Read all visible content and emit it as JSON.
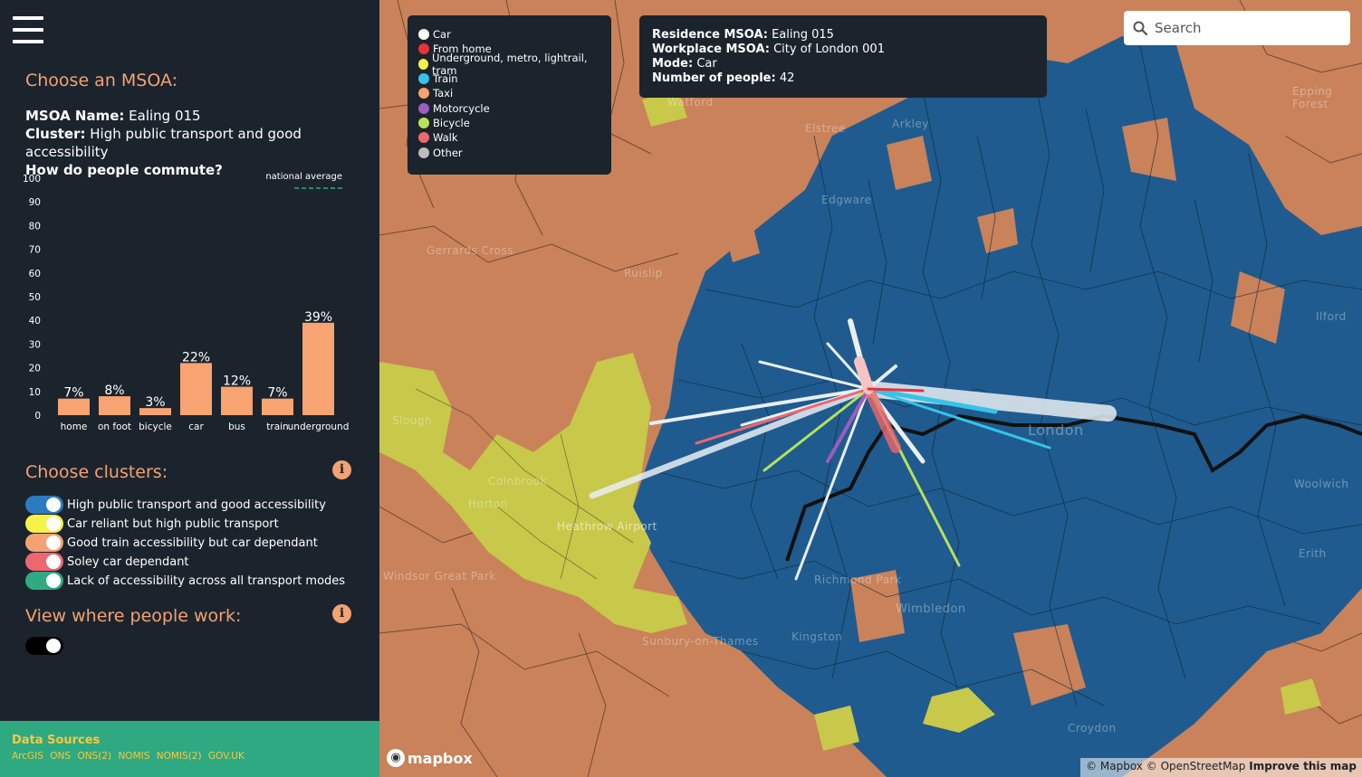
{
  "sidebar": {
    "menu_icon": "hamburger-icon",
    "choose_msoa_title": "Choose an MSOA:",
    "msoa": {
      "name_label": "MSOA Name:",
      "name_value": "Ealing 015",
      "cluster_label": "Cluster:",
      "cluster_value": "High public transport and good accessibility",
      "commute_question": "How do people commute?"
    },
    "choose_clusters_title": "Choose clusters:",
    "clusters": [
      {
        "label": "High public transport and good accessibility",
        "color": "#2b7bc0",
        "on": true
      },
      {
        "label": "Car reliant but high public transport",
        "color": "#f5f24a",
        "on": true
      },
      {
        "label": "Good train accessibility but car dependant",
        "color": "#f4a173",
        "on": true
      },
      {
        "label": "Soley car dependant",
        "color": "#ee6670",
        "on": true
      },
      {
        "label": "Lack of accessibility across all transport modes",
        "color": "#2fa981",
        "on": true
      }
    ],
    "view_work_title": "View where people work:",
    "view_work_toggle": {
      "on": false
    },
    "info_icon": "i",
    "data_sources": {
      "title": "Data Sources",
      "links": [
        "ArcGIS",
        "ONS",
        "ONS(2)",
        "NOMIS",
        "NOMIS(2)",
        "GOV.UK"
      ]
    }
  },
  "chart_data": {
    "type": "bar",
    "categories": [
      "home",
      "on foot",
      "bicycle",
      "car",
      "bus",
      "train",
      "underground"
    ],
    "values": [
      7,
      8,
      3,
      22,
      12,
      7,
      39
    ],
    "data_labels": [
      "7%",
      "8%",
      "3%",
      "22%",
      "12%",
      "7%",
      "39%"
    ],
    "ylim": [
      0,
      100
    ],
    "yticks": [
      0,
      10,
      20,
      30,
      40,
      50,
      60,
      70,
      80,
      90,
      100
    ],
    "legend": "national average",
    "legend_position": "top-right",
    "bar_color": "#f7a372",
    "grid": false
  },
  "map": {
    "legend": [
      {
        "label": "Car",
        "color": "#ffffff"
      },
      {
        "label": "From home",
        "color": "#e8323a"
      },
      {
        "label": "Underground, metro, lightrail, tram",
        "color": "#f5f24a"
      },
      {
        "label": "Train",
        "color": "#36c3ea"
      },
      {
        "label": "Taxi",
        "color": "#f7a372"
      },
      {
        "label": "Motorcycle",
        "color": "#9c5cc0"
      },
      {
        "label": "Bicycle",
        "color": "#b6e35a"
      },
      {
        "label": "Walk",
        "color": "#ee6670"
      },
      {
        "label": "Other",
        "color": "#bdbdbd"
      }
    ],
    "tooltip": {
      "residence_label": "Residence MSOA:",
      "residence_value": "Ealing 015",
      "workplace_label": "Workplace MSOA:",
      "workplace_value": "City of London 001",
      "mode_label": "Mode:",
      "mode_value": "Car",
      "people_label": "Number of people:",
      "people_value": "42"
    },
    "search": {
      "placeholder": "Search",
      "icon": "search-icon"
    },
    "logo_text": "mapbox",
    "attribution": {
      "mapbox": "© Mapbox",
      "osm": "© OpenStreetMap",
      "improve": "Improve this map"
    },
    "places": [
      "Epping Forest",
      "Watford",
      "Elstree",
      "Arkley",
      "Edgware",
      "Gerrards Cross",
      "Ruislip",
      "Slough",
      "Heathrow Airport",
      "London",
      "Richmond Park",
      "Wimbledon",
      "Kingston",
      "Sunbury-on-Thames",
      "Croydon",
      "Horton",
      "Windsor Great Park",
      "Colnbrook",
      "Ilford",
      "Woolwich",
      "Erith"
    ]
  },
  "colors": {
    "sidebar_bg": "#1b242d",
    "accent_orange": "#f4a173",
    "map_orange": "#c9825a",
    "map_blue": "#1f5b8e",
    "map_yellow": "#c8c84a",
    "datasource_green": "#2fa981"
  }
}
